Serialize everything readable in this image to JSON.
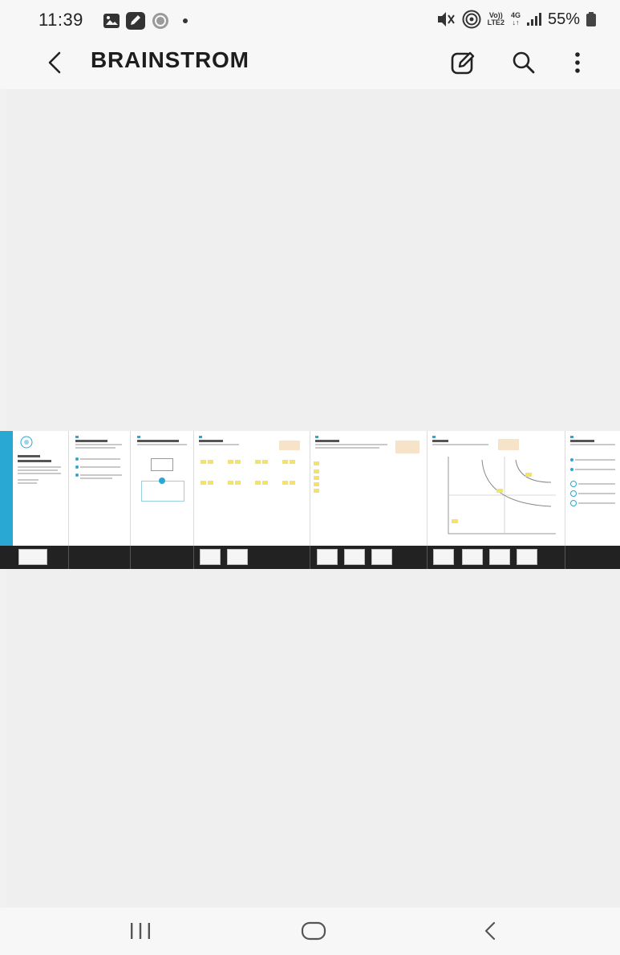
{
  "status_bar": {
    "time": "11:39",
    "net_top": "Vo))",
    "net_bottom": "LTE2",
    "gen_top": "4G",
    "gen_bottom": "↓↑",
    "battery": "55%"
  },
  "app_bar": {
    "title": "BRAINSTROM",
    "icons": [
      "back-arrow-icon",
      "edit-icon",
      "search-icon",
      "more-vert-icon"
    ]
  },
  "board": {
    "frame_count": 7,
    "accent_color": "#29a8d4",
    "sticky_color": "#f3e36b",
    "strip_color": "#222222"
  },
  "nav_bar": {
    "icons": [
      "recent-apps-icon",
      "home-icon",
      "back-icon"
    ]
  }
}
